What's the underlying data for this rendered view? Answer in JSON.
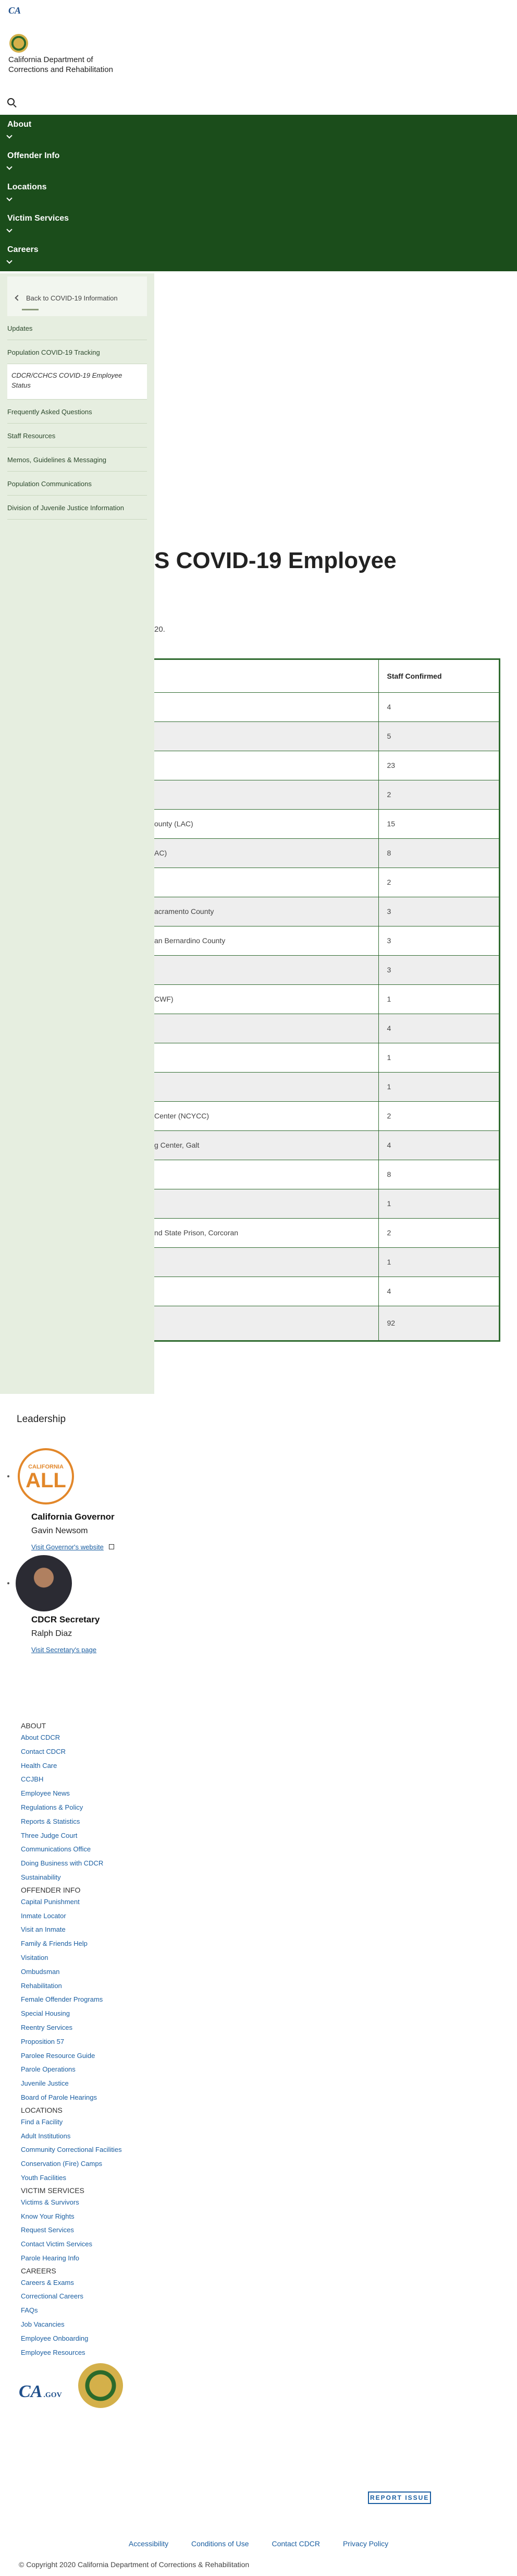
{
  "header": {
    "logo_text": "CA",
    "department_name": "California Department of Corrections and Rehabilitation"
  },
  "nav": [
    {
      "label": "About"
    },
    {
      "label": "Offender Info"
    },
    {
      "label": "Locations"
    },
    {
      "label": "Victim Services"
    },
    {
      "label": "Careers"
    }
  ],
  "sidebar": {
    "back_link": "Back to COVID-19 Information",
    "items": [
      {
        "label": "Updates"
      },
      {
        "label": "Population COVID-19 Tracking"
      },
      {
        "label": "CDCR/CCHCS COVID-19 Employee Status"
      },
      {
        "label": "Frequently Asked Questions"
      },
      {
        "label": "Staff Resources"
      },
      {
        "label": "Memos, Guidelines & Messaging"
      },
      {
        "label": "Population Communications"
      },
      {
        "label": "Division of Juvenile Justice Information"
      }
    ]
  },
  "main": {
    "title": "S COVID-19 Employee",
    "updated": "20.",
    "table": {
      "header_location": "",
      "header_count": "Staff Confirmed",
      "rows": [
        {
          "location": "",
          "count": "4"
        },
        {
          "location": "",
          "count": "5"
        },
        {
          "location": "",
          "count": "23"
        },
        {
          "location": "",
          "count": "2"
        },
        {
          "location": "ounty (LAC)",
          "count": "15"
        },
        {
          "location": "AC)",
          "count": "8"
        },
        {
          "location": "",
          "count": "2"
        },
        {
          "location": "acramento County",
          "count": "3"
        },
        {
          "location": "an Bernardino County",
          "count": "3"
        },
        {
          "location": "",
          "count": "3"
        },
        {
          "location": "CWF)",
          "count": "1"
        },
        {
          "location": "",
          "count": "4"
        },
        {
          "location": "",
          "count": "1"
        },
        {
          "location": "",
          "count": "1"
        },
        {
          "location": "Center (NCYCC)",
          "count": "2"
        },
        {
          "location": "g Center, Galt",
          "count": "4"
        },
        {
          "location": "",
          "count": "8"
        },
        {
          "location": "",
          "count": "1"
        },
        {
          "location": "nd State Prison, Corcoran",
          "count": "2"
        },
        {
          "location": "",
          "count": "1"
        },
        {
          "location": "",
          "count": "4"
        },
        {
          "location": "",
          "count": "92"
        }
      ]
    }
  },
  "leadership": {
    "heading": "Leadership",
    "governor": {
      "badge_top": "CALIFORNIA",
      "badge_main": "ALL",
      "title": "California Governor",
      "name": "Gavin Newsom",
      "link": "Visit Governor's website"
    },
    "secretary": {
      "title": "CDCR Secretary",
      "name": "Ralph Diaz",
      "link": "Visit Secretary's page"
    }
  },
  "footer": {
    "sections": [
      {
        "title": "About",
        "links": [
          "About CDCR",
          "Contact CDCR",
          "Health Care",
          "CCJBH",
          "Employee News",
          "Regulations & Policy",
          "Reports & Statistics",
          "Three Judge Court",
          "Communications Office",
          "Doing Business with CDCR",
          "Sustainability"
        ]
      },
      {
        "title": "Offender Info",
        "links": [
          "Capital Punishment",
          "Inmate Locator",
          "Visit an Inmate",
          "Family & Friends Help",
          "Visitation",
          "Ombudsman",
          "Rehabilitation",
          "Female Offender Programs",
          "Special Housing",
          "Reentry Services",
          "Proposition 57",
          "Parolee Resource Guide",
          "Parole Operations",
          "Juvenile Justice",
          "Board of Parole Hearings"
        ]
      },
      {
        "title": "Locations",
        "links": [
          "Find a Facility",
          "Adult Institutions",
          "Community Correctional Facilities",
          "Conservation (Fire) Camps",
          "Youth Facilities"
        ]
      },
      {
        "title": "Victim Services",
        "links": [
          "Victims & Survivors",
          "Know Your Rights",
          "Request Services",
          "Contact Victim Services",
          "Parole Hearing Info"
        ]
      },
      {
        "title": "Careers",
        "links": [
          "Careers & Exams",
          "Correctional Careers",
          "FAQs",
          "Job Vacancies",
          "Employee Onboarding",
          "Employee Resources"
        ]
      }
    ],
    "ca_gov_text": "CA",
    "ca_gov_suffix": ".GOV",
    "report_issue": "REPORT ISSUE",
    "bottom_links": [
      "Accessibility",
      "Conditions of Use",
      "Contact CDCR",
      "Privacy Policy"
    ],
    "copyright": "© Copyright 2020 California Department of Corrections & Rehabilitation"
  },
  "colors": {
    "nav_bg": "#1b4d1b",
    "sidebar_bg": "#e6eee0",
    "link": "#1a5ea1",
    "table_border": "#2f6b2f"
  }
}
